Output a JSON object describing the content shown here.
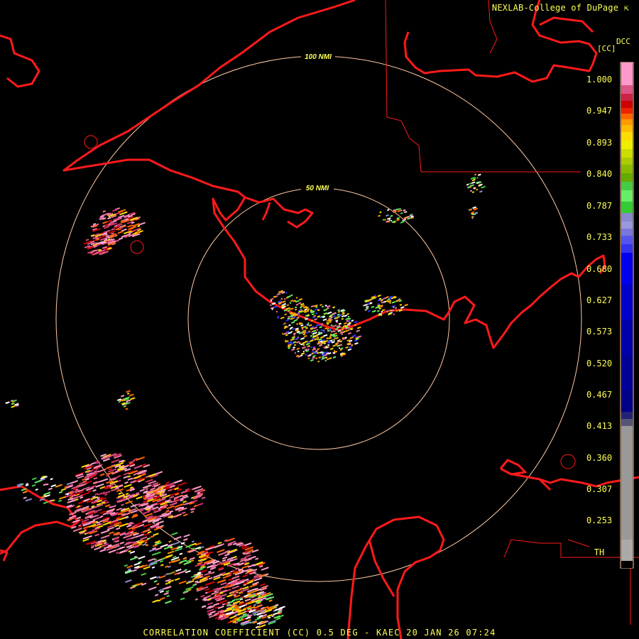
{
  "header": {
    "credit": "NEXLAB-College of DuPage",
    "product_code": "DCC",
    "product_unit": "[CC]"
  },
  "footer": {
    "title": "CORRELATION COEFFICIENT (CC) 0.5 DEG - KAEC 20 JAN 26 07:24"
  },
  "range_rings": [
    {
      "label": "50 NMI"
    },
    {
      "label": "100 NMI"
    }
  ],
  "colorbar": {
    "labels": [
      "1.000",
      "0.947",
      "0.893",
      "0.840",
      "0.787",
      "0.733",
      "0.680",
      "0.627",
      "0.573",
      "0.520",
      "0.467",
      "0.413",
      "0.360",
      "0.307",
      "0.253",
      "TH"
    ]
  },
  "colors": {
    "background": "#000000",
    "boundary": "#ff1a1a",
    "ring": "#ffc8a0",
    "text": "#ffff55"
  }
}
